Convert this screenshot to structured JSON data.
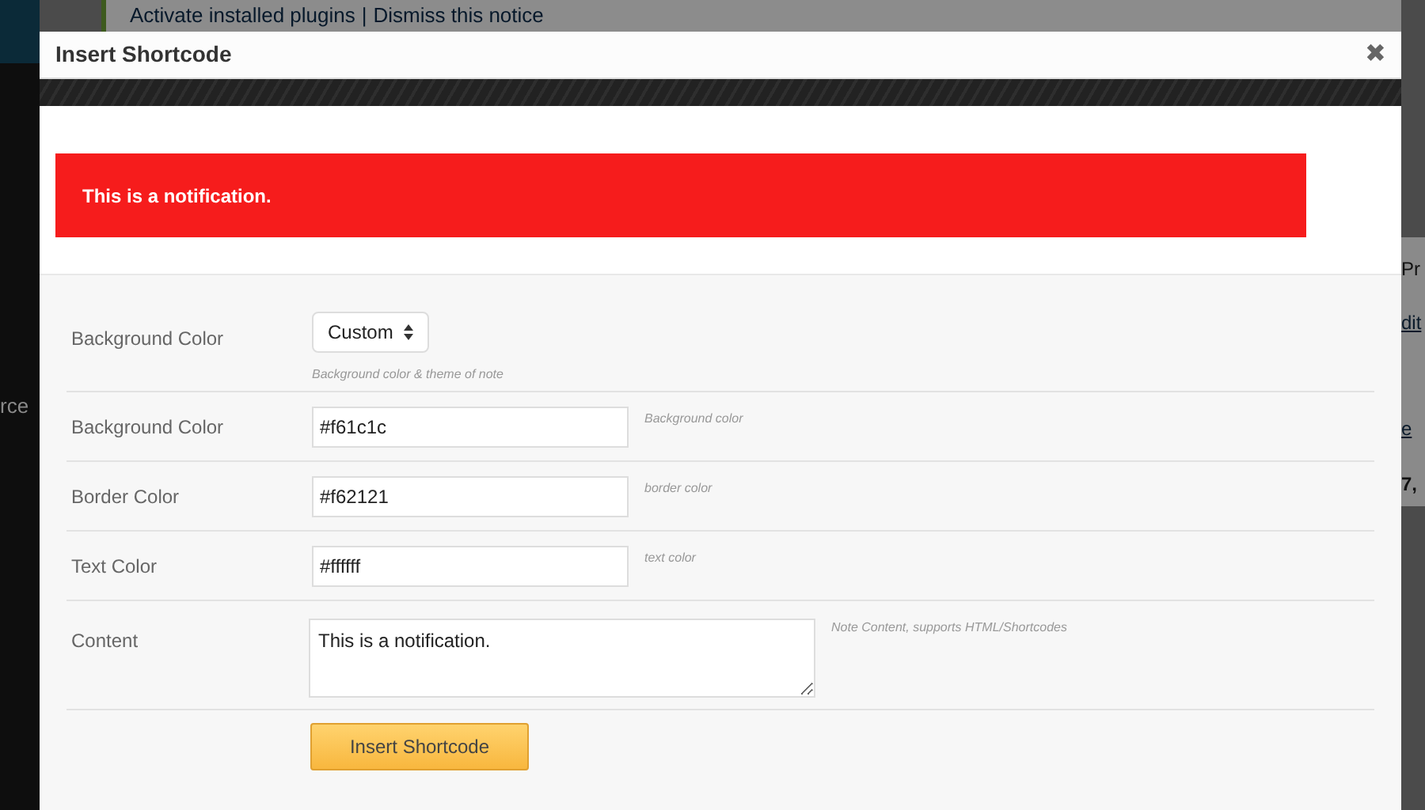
{
  "background_page": {
    "notice_links": [
      "Activate installed plugins",
      "Dismiss this notice"
    ],
    "notice_separator": "|",
    "sidebar_fragment": "rce",
    "right_fragments": [
      "Pr",
      "dit",
      "e",
      "7,"
    ]
  },
  "modal": {
    "title": "Insert Shortcode",
    "close": "✖",
    "preview": {
      "text": "This is a notification."
    },
    "fields": [
      {
        "kind": "select",
        "label": "Background Color",
        "value": "Custom",
        "hint": "Background color & theme of note"
      },
      {
        "kind": "text",
        "label": "Background Color",
        "value": "#f61c1c",
        "hint": "Background color"
      },
      {
        "kind": "text",
        "label": "Border Color",
        "value": "#f62121",
        "hint": "border color"
      },
      {
        "kind": "text",
        "label": "Text Color",
        "value": "#ffffff",
        "hint": "text color"
      },
      {
        "kind": "textarea",
        "label": "Content",
        "value": "This is a notification.",
        "hint": "Note Content, supports HTML/Shortcodes"
      }
    ],
    "submit": "Insert Shortcode"
  }
}
